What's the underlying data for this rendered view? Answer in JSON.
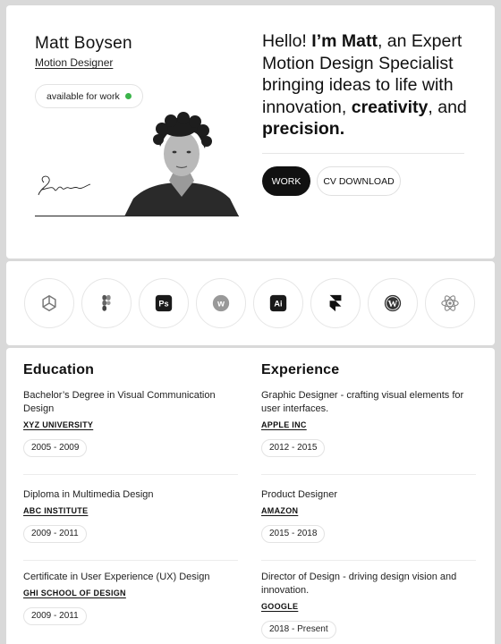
{
  "hero": {
    "name": "Matt Boysen",
    "role": "Motion Designer",
    "availability": "available for work",
    "availability_color": "#3bb44a",
    "signature": "Signature",
    "intro": {
      "p1": "Hello! ",
      "p2": "I’m Matt",
      "p3": ", an Expert Motion Design Specialist bringing ideas to life with innovation, ",
      "p4": "creativity",
      "p5": ", and ",
      "p6": "precision."
    },
    "work_label": "WORK",
    "cv_label": "CV DOWNLOAD"
  },
  "tools": [
    {
      "icon": "chatgpt-icon"
    },
    {
      "icon": "figma-icon"
    },
    {
      "icon": "photoshop-icon",
      "text": "Ps"
    },
    {
      "icon": "webflow-icon",
      "text": "w"
    },
    {
      "icon": "illustrator-icon",
      "text": "Ai"
    },
    {
      "icon": "framer-icon"
    },
    {
      "icon": "wordpress-icon"
    },
    {
      "icon": "react-icon"
    }
  ],
  "education": {
    "title": "Education",
    "items": [
      {
        "title": "Bachelor’s Degree in Visual Communication Design",
        "org": "XYZ UNIVERSITY",
        "years": "2005 - 2009"
      },
      {
        "title": "Diploma in Multimedia Design",
        "org": "ABC INSTITUTE",
        "years": "2009 - 2011"
      },
      {
        "title": "Certificate in User Experience (UX) Design",
        "org": "GHI SCHOOL OF DESIGN",
        "years": "2009 - 2011"
      }
    ]
  },
  "experience": {
    "title": "Experience",
    "items": [
      {
        "title": "Graphic Designer - crafting visual elements for user interfaces.",
        "org": "APPLE INC",
        "years": "2012 - 2015"
      },
      {
        "title": "Product Designer",
        "org": "AMAZON",
        "years": "2015 - 2018"
      },
      {
        "title": "Director of Design - driving design vision and innovation.",
        "org": "GOOGLE",
        "years": "2018 - Present"
      }
    ]
  }
}
